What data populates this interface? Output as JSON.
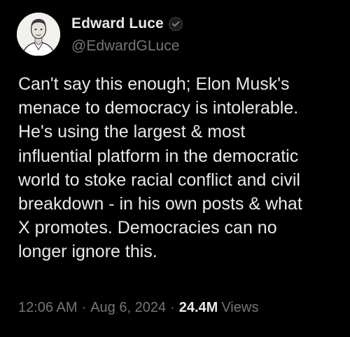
{
  "author": {
    "display_name": "Edward Luce",
    "handle": "@EdwardGLuce",
    "verified_icon": "verified-badge"
  },
  "post": {
    "lines": [
      "Can't say this enough; Elon Musk's",
      "menace to democracy is intolerable.",
      "He's using the largest & most",
      "influential platform in the democratic",
      "world to stoke racial conflict and civil",
      "breakdown - in his own posts & what",
      "X promotes. Democracies can no",
      "longer ignore this."
    ]
  },
  "meta": {
    "time": "12:06 AM",
    "separator": "·",
    "date": "Aug 6, 2024",
    "views_count": "24.4M",
    "views_label": "Views"
  },
  "colors": {
    "background": "#000000",
    "primary_text": "#e7e9ea",
    "secondary_text": "#71767b"
  }
}
